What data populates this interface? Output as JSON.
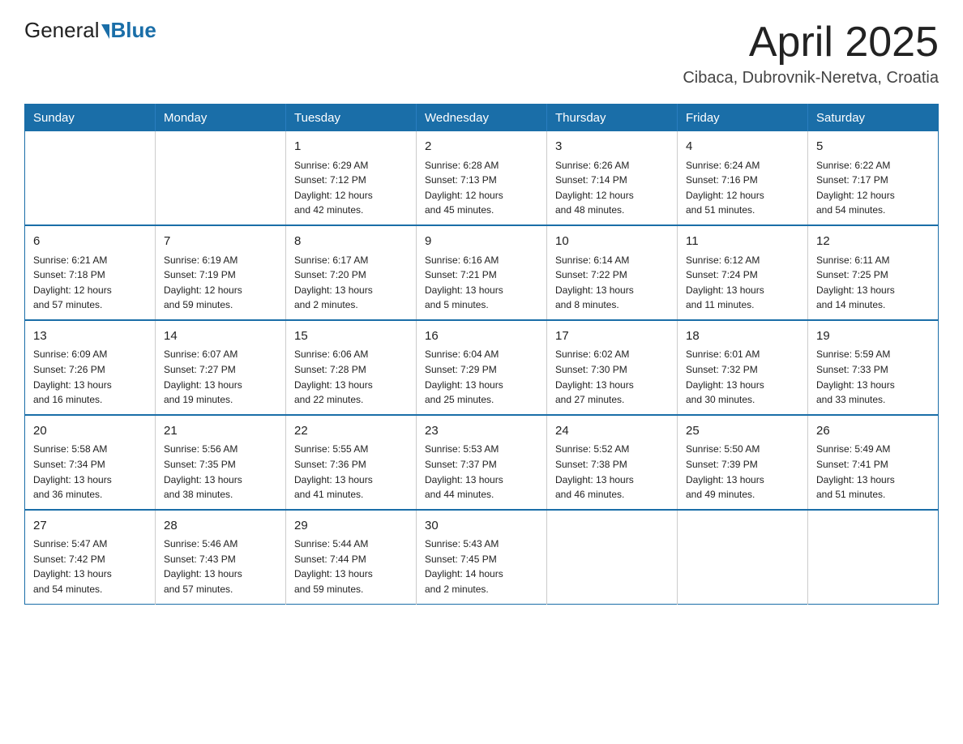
{
  "logo": {
    "general": "General",
    "blue": "Blue"
  },
  "title": "April 2025",
  "subtitle": "Cibaca, Dubrovnik-Neretva, Croatia",
  "header": {
    "colors": {
      "bg": "#1a6ea8"
    }
  },
  "days_of_week": [
    "Sunday",
    "Monday",
    "Tuesday",
    "Wednesday",
    "Thursday",
    "Friday",
    "Saturday"
  ],
  "weeks": [
    [
      {
        "day": "",
        "info": ""
      },
      {
        "day": "",
        "info": ""
      },
      {
        "day": "1",
        "info": "Sunrise: 6:29 AM\nSunset: 7:12 PM\nDaylight: 12 hours\nand 42 minutes."
      },
      {
        "day": "2",
        "info": "Sunrise: 6:28 AM\nSunset: 7:13 PM\nDaylight: 12 hours\nand 45 minutes."
      },
      {
        "day": "3",
        "info": "Sunrise: 6:26 AM\nSunset: 7:14 PM\nDaylight: 12 hours\nand 48 minutes."
      },
      {
        "day": "4",
        "info": "Sunrise: 6:24 AM\nSunset: 7:16 PM\nDaylight: 12 hours\nand 51 minutes."
      },
      {
        "day": "5",
        "info": "Sunrise: 6:22 AM\nSunset: 7:17 PM\nDaylight: 12 hours\nand 54 minutes."
      }
    ],
    [
      {
        "day": "6",
        "info": "Sunrise: 6:21 AM\nSunset: 7:18 PM\nDaylight: 12 hours\nand 57 minutes."
      },
      {
        "day": "7",
        "info": "Sunrise: 6:19 AM\nSunset: 7:19 PM\nDaylight: 12 hours\nand 59 minutes."
      },
      {
        "day": "8",
        "info": "Sunrise: 6:17 AM\nSunset: 7:20 PM\nDaylight: 13 hours\nand 2 minutes."
      },
      {
        "day": "9",
        "info": "Sunrise: 6:16 AM\nSunset: 7:21 PM\nDaylight: 13 hours\nand 5 minutes."
      },
      {
        "day": "10",
        "info": "Sunrise: 6:14 AM\nSunset: 7:22 PM\nDaylight: 13 hours\nand 8 minutes."
      },
      {
        "day": "11",
        "info": "Sunrise: 6:12 AM\nSunset: 7:24 PM\nDaylight: 13 hours\nand 11 minutes."
      },
      {
        "day": "12",
        "info": "Sunrise: 6:11 AM\nSunset: 7:25 PM\nDaylight: 13 hours\nand 14 minutes."
      }
    ],
    [
      {
        "day": "13",
        "info": "Sunrise: 6:09 AM\nSunset: 7:26 PM\nDaylight: 13 hours\nand 16 minutes."
      },
      {
        "day": "14",
        "info": "Sunrise: 6:07 AM\nSunset: 7:27 PM\nDaylight: 13 hours\nand 19 minutes."
      },
      {
        "day": "15",
        "info": "Sunrise: 6:06 AM\nSunset: 7:28 PM\nDaylight: 13 hours\nand 22 minutes."
      },
      {
        "day": "16",
        "info": "Sunrise: 6:04 AM\nSunset: 7:29 PM\nDaylight: 13 hours\nand 25 minutes."
      },
      {
        "day": "17",
        "info": "Sunrise: 6:02 AM\nSunset: 7:30 PM\nDaylight: 13 hours\nand 27 minutes."
      },
      {
        "day": "18",
        "info": "Sunrise: 6:01 AM\nSunset: 7:32 PM\nDaylight: 13 hours\nand 30 minutes."
      },
      {
        "day": "19",
        "info": "Sunrise: 5:59 AM\nSunset: 7:33 PM\nDaylight: 13 hours\nand 33 minutes."
      }
    ],
    [
      {
        "day": "20",
        "info": "Sunrise: 5:58 AM\nSunset: 7:34 PM\nDaylight: 13 hours\nand 36 minutes."
      },
      {
        "day": "21",
        "info": "Sunrise: 5:56 AM\nSunset: 7:35 PM\nDaylight: 13 hours\nand 38 minutes."
      },
      {
        "day": "22",
        "info": "Sunrise: 5:55 AM\nSunset: 7:36 PM\nDaylight: 13 hours\nand 41 minutes."
      },
      {
        "day": "23",
        "info": "Sunrise: 5:53 AM\nSunset: 7:37 PM\nDaylight: 13 hours\nand 44 minutes."
      },
      {
        "day": "24",
        "info": "Sunrise: 5:52 AM\nSunset: 7:38 PM\nDaylight: 13 hours\nand 46 minutes."
      },
      {
        "day": "25",
        "info": "Sunrise: 5:50 AM\nSunset: 7:39 PM\nDaylight: 13 hours\nand 49 minutes."
      },
      {
        "day": "26",
        "info": "Sunrise: 5:49 AM\nSunset: 7:41 PM\nDaylight: 13 hours\nand 51 minutes."
      }
    ],
    [
      {
        "day": "27",
        "info": "Sunrise: 5:47 AM\nSunset: 7:42 PM\nDaylight: 13 hours\nand 54 minutes."
      },
      {
        "day": "28",
        "info": "Sunrise: 5:46 AM\nSunset: 7:43 PM\nDaylight: 13 hours\nand 57 minutes."
      },
      {
        "day": "29",
        "info": "Sunrise: 5:44 AM\nSunset: 7:44 PM\nDaylight: 13 hours\nand 59 minutes."
      },
      {
        "day": "30",
        "info": "Sunrise: 5:43 AM\nSunset: 7:45 PM\nDaylight: 14 hours\nand 2 minutes."
      },
      {
        "day": "",
        "info": ""
      },
      {
        "day": "",
        "info": ""
      },
      {
        "day": "",
        "info": ""
      }
    ]
  ]
}
